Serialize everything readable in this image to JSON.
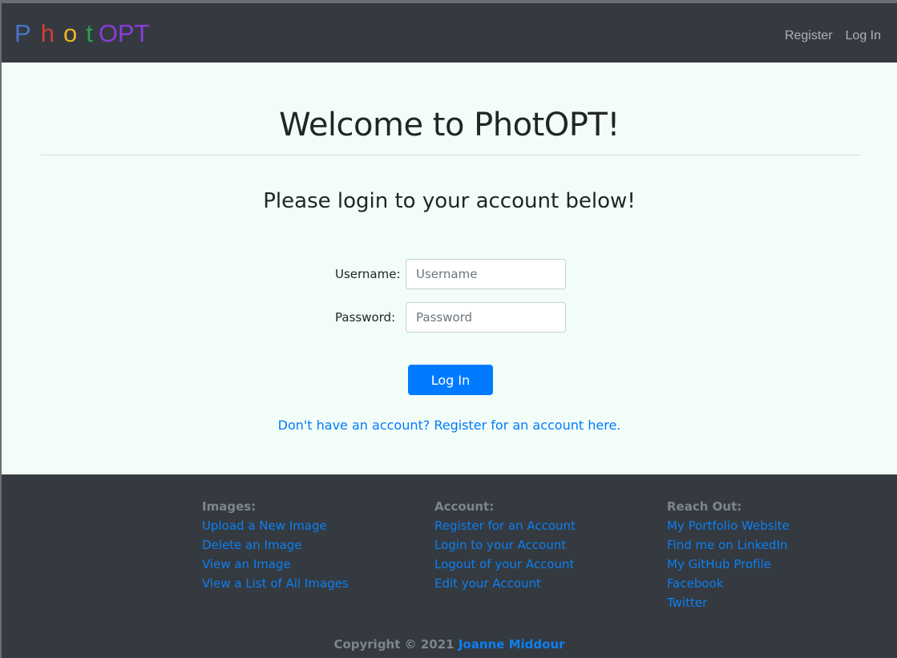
{
  "brand": {
    "letters": [
      {
        "char": "P",
        "color": "#4b74c9"
      },
      {
        "char": "h",
        "color": "#d43f3a"
      },
      {
        "char": "o",
        "color": "#f0b323"
      },
      {
        "char": "t",
        "color": "#2e9f48"
      },
      {
        "char": "OPT",
        "color": "#8a3ddb"
      }
    ]
  },
  "nav": {
    "register": "Register",
    "login": "Log In"
  },
  "main": {
    "title": "Welcome to PhotOPT!",
    "subtitle": "Please login to your account below!",
    "username_label": "Username:",
    "username_placeholder": "Username",
    "password_label": "Password:",
    "password_placeholder": "Password",
    "login_button": "Log In",
    "register_link": "Don't have an account? Register for an account here."
  },
  "footer": {
    "columns": [
      {
        "heading": "Images:",
        "links": [
          "Upload a New Image",
          "Delete an Image",
          "View an Image",
          "View a List of All Images"
        ]
      },
      {
        "heading": "Account:",
        "links": [
          "Register for an Account",
          "Login to your Account",
          "Logout of your Account",
          "Edit your Account"
        ]
      },
      {
        "heading": "Reach Out:",
        "links": [
          "My Portfolio Website",
          "Find me on LinkedIn",
          "My GitHub Profile",
          "Facebook",
          "Twitter"
        ]
      }
    ],
    "copyright_prefix": "Copyright © 2021",
    "copyright_name": "Joanne Middour"
  }
}
